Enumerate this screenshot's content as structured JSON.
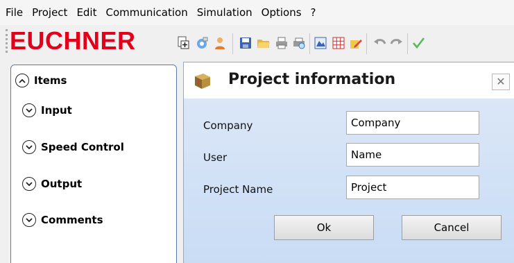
{
  "menubar": {
    "items": [
      {
        "label": "File"
      },
      {
        "label": "Project"
      },
      {
        "label": "Edit"
      },
      {
        "label": "Communication"
      },
      {
        "label": "Simulation"
      },
      {
        "label": "Options"
      },
      {
        "label": "?"
      }
    ]
  },
  "toolbar": {
    "logo": "EUCHNER",
    "icons": [
      "new-project-icon",
      "configure-icon",
      "user-icon",
      "save-icon",
      "open-folder-icon",
      "print-icon",
      "print-preview-icon",
      "image-icon",
      "grid-icon",
      "edit-icon",
      "undo-icon",
      "redo-icon",
      "check-icon"
    ],
    "brand_color": "#e2001a"
  },
  "sidebar": {
    "header": "Items",
    "items": [
      {
        "label": "Input"
      },
      {
        "label": "Speed Control"
      },
      {
        "label": "Output"
      },
      {
        "label": "Comments"
      }
    ]
  },
  "dialog": {
    "title": "Project information",
    "close_glyph": "✕",
    "fields": [
      {
        "label": "Company",
        "value": "Company"
      },
      {
        "label": "User",
        "value": "Name"
      },
      {
        "label": "Project Name",
        "value": "Project"
      }
    ],
    "ok_label": "Ok",
    "cancel_label": "Cancel"
  }
}
